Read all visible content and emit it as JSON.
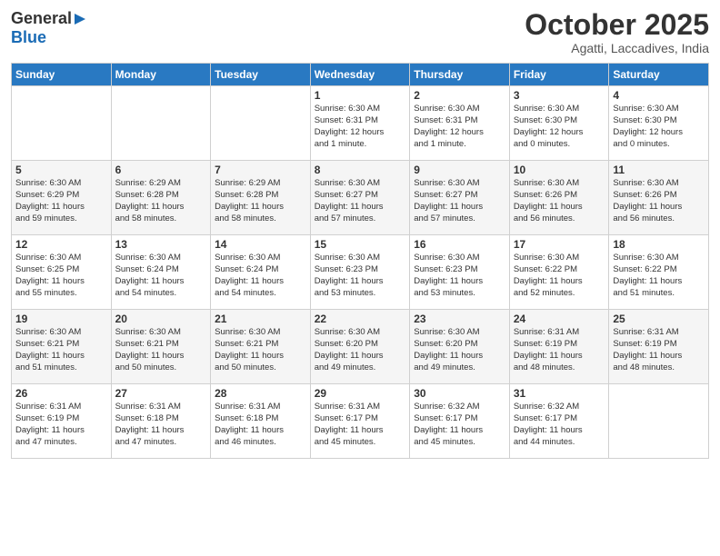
{
  "header": {
    "logo_general": "General",
    "logo_blue": "Blue",
    "month_title": "October 2025",
    "subtitle": "Agatti, Laccadives, India"
  },
  "days_of_week": [
    "Sunday",
    "Monday",
    "Tuesday",
    "Wednesday",
    "Thursday",
    "Friday",
    "Saturday"
  ],
  "weeks": [
    [
      {
        "day": "",
        "info": ""
      },
      {
        "day": "",
        "info": ""
      },
      {
        "day": "",
        "info": ""
      },
      {
        "day": "1",
        "info": "Sunrise: 6:30 AM\nSunset: 6:31 PM\nDaylight: 12 hours\nand 1 minute."
      },
      {
        "day": "2",
        "info": "Sunrise: 6:30 AM\nSunset: 6:31 PM\nDaylight: 12 hours\nand 1 minute."
      },
      {
        "day": "3",
        "info": "Sunrise: 6:30 AM\nSunset: 6:30 PM\nDaylight: 12 hours\nand 0 minutes."
      },
      {
        "day": "4",
        "info": "Sunrise: 6:30 AM\nSunset: 6:30 PM\nDaylight: 12 hours\nand 0 minutes."
      }
    ],
    [
      {
        "day": "5",
        "info": "Sunrise: 6:30 AM\nSunset: 6:29 PM\nDaylight: 11 hours\nand 59 minutes."
      },
      {
        "day": "6",
        "info": "Sunrise: 6:29 AM\nSunset: 6:28 PM\nDaylight: 11 hours\nand 58 minutes."
      },
      {
        "day": "7",
        "info": "Sunrise: 6:29 AM\nSunset: 6:28 PM\nDaylight: 11 hours\nand 58 minutes."
      },
      {
        "day": "8",
        "info": "Sunrise: 6:30 AM\nSunset: 6:27 PM\nDaylight: 11 hours\nand 57 minutes."
      },
      {
        "day": "9",
        "info": "Sunrise: 6:30 AM\nSunset: 6:27 PM\nDaylight: 11 hours\nand 57 minutes."
      },
      {
        "day": "10",
        "info": "Sunrise: 6:30 AM\nSunset: 6:26 PM\nDaylight: 11 hours\nand 56 minutes."
      },
      {
        "day": "11",
        "info": "Sunrise: 6:30 AM\nSunset: 6:26 PM\nDaylight: 11 hours\nand 56 minutes."
      }
    ],
    [
      {
        "day": "12",
        "info": "Sunrise: 6:30 AM\nSunset: 6:25 PM\nDaylight: 11 hours\nand 55 minutes."
      },
      {
        "day": "13",
        "info": "Sunrise: 6:30 AM\nSunset: 6:24 PM\nDaylight: 11 hours\nand 54 minutes."
      },
      {
        "day": "14",
        "info": "Sunrise: 6:30 AM\nSunset: 6:24 PM\nDaylight: 11 hours\nand 54 minutes."
      },
      {
        "day": "15",
        "info": "Sunrise: 6:30 AM\nSunset: 6:23 PM\nDaylight: 11 hours\nand 53 minutes."
      },
      {
        "day": "16",
        "info": "Sunrise: 6:30 AM\nSunset: 6:23 PM\nDaylight: 11 hours\nand 53 minutes."
      },
      {
        "day": "17",
        "info": "Sunrise: 6:30 AM\nSunset: 6:22 PM\nDaylight: 11 hours\nand 52 minutes."
      },
      {
        "day": "18",
        "info": "Sunrise: 6:30 AM\nSunset: 6:22 PM\nDaylight: 11 hours\nand 51 minutes."
      }
    ],
    [
      {
        "day": "19",
        "info": "Sunrise: 6:30 AM\nSunset: 6:21 PM\nDaylight: 11 hours\nand 51 minutes."
      },
      {
        "day": "20",
        "info": "Sunrise: 6:30 AM\nSunset: 6:21 PM\nDaylight: 11 hours\nand 50 minutes."
      },
      {
        "day": "21",
        "info": "Sunrise: 6:30 AM\nSunset: 6:21 PM\nDaylight: 11 hours\nand 50 minutes."
      },
      {
        "day": "22",
        "info": "Sunrise: 6:30 AM\nSunset: 6:20 PM\nDaylight: 11 hours\nand 49 minutes."
      },
      {
        "day": "23",
        "info": "Sunrise: 6:30 AM\nSunset: 6:20 PM\nDaylight: 11 hours\nand 49 minutes."
      },
      {
        "day": "24",
        "info": "Sunrise: 6:31 AM\nSunset: 6:19 PM\nDaylight: 11 hours\nand 48 minutes."
      },
      {
        "day": "25",
        "info": "Sunrise: 6:31 AM\nSunset: 6:19 PM\nDaylight: 11 hours\nand 48 minutes."
      }
    ],
    [
      {
        "day": "26",
        "info": "Sunrise: 6:31 AM\nSunset: 6:19 PM\nDaylight: 11 hours\nand 47 minutes."
      },
      {
        "day": "27",
        "info": "Sunrise: 6:31 AM\nSunset: 6:18 PM\nDaylight: 11 hours\nand 47 minutes."
      },
      {
        "day": "28",
        "info": "Sunrise: 6:31 AM\nSunset: 6:18 PM\nDaylight: 11 hours\nand 46 minutes."
      },
      {
        "day": "29",
        "info": "Sunrise: 6:31 AM\nSunset: 6:17 PM\nDaylight: 11 hours\nand 45 minutes."
      },
      {
        "day": "30",
        "info": "Sunrise: 6:32 AM\nSunset: 6:17 PM\nDaylight: 11 hours\nand 45 minutes."
      },
      {
        "day": "31",
        "info": "Sunrise: 6:32 AM\nSunset: 6:17 PM\nDaylight: 11 hours\nand 44 minutes."
      },
      {
        "day": "",
        "info": ""
      }
    ]
  ]
}
